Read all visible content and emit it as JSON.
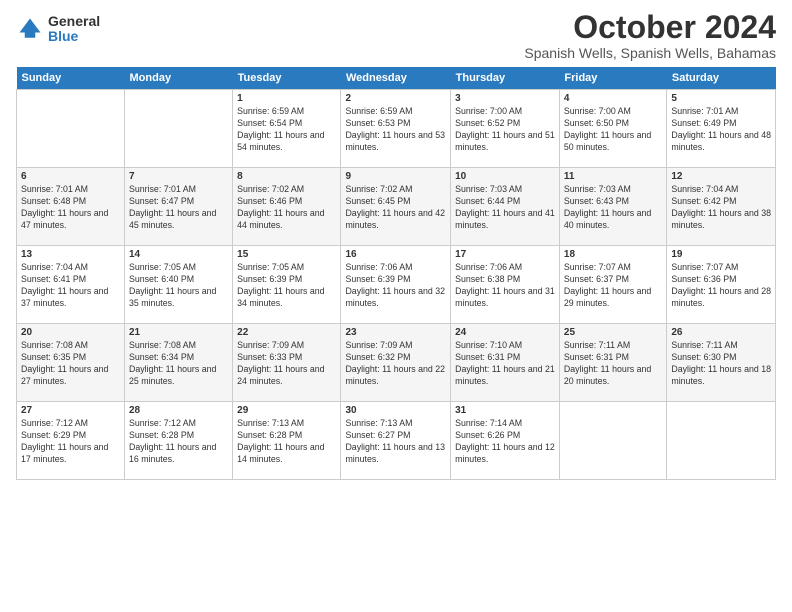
{
  "logo": {
    "general": "General",
    "blue": "Blue"
  },
  "header": {
    "month": "October 2024",
    "location": "Spanish Wells, Spanish Wells, Bahamas"
  },
  "weekdays": [
    "Sunday",
    "Monday",
    "Tuesday",
    "Wednesday",
    "Thursday",
    "Friday",
    "Saturday"
  ],
  "weeks": [
    [
      {
        "day": "",
        "sunrise": "",
        "sunset": "",
        "daylight": ""
      },
      {
        "day": "",
        "sunrise": "",
        "sunset": "",
        "daylight": ""
      },
      {
        "day": "1",
        "sunrise": "Sunrise: 6:59 AM",
        "sunset": "Sunset: 6:54 PM",
        "daylight": "Daylight: 11 hours and 54 minutes."
      },
      {
        "day": "2",
        "sunrise": "Sunrise: 6:59 AM",
        "sunset": "Sunset: 6:53 PM",
        "daylight": "Daylight: 11 hours and 53 minutes."
      },
      {
        "day": "3",
        "sunrise": "Sunrise: 7:00 AM",
        "sunset": "Sunset: 6:52 PM",
        "daylight": "Daylight: 11 hours and 51 minutes."
      },
      {
        "day": "4",
        "sunrise": "Sunrise: 7:00 AM",
        "sunset": "Sunset: 6:50 PM",
        "daylight": "Daylight: 11 hours and 50 minutes."
      },
      {
        "day": "5",
        "sunrise": "Sunrise: 7:01 AM",
        "sunset": "Sunset: 6:49 PM",
        "daylight": "Daylight: 11 hours and 48 minutes."
      }
    ],
    [
      {
        "day": "6",
        "sunrise": "Sunrise: 7:01 AM",
        "sunset": "Sunset: 6:48 PM",
        "daylight": "Daylight: 11 hours and 47 minutes."
      },
      {
        "day": "7",
        "sunrise": "Sunrise: 7:01 AM",
        "sunset": "Sunset: 6:47 PM",
        "daylight": "Daylight: 11 hours and 45 minutes."
      },
      {
        "day": "8",
        "sunrise": "Sunrise: 7:02 AM",
        "sunset": "Sunset: 6:46 PM",
        "daylight": "Daylight: 11 hours and 44 minutes."
      },
      {
        "day": "9",
        "sunrise": "Sunrise: 7:02 AM",
        "sunset": "Sunset: 6:45 PM",
        "daylight": "Daylight: 11 hours and 42 minutes."
      },
      {
        "day": "10",
        "sunrise": "Sunrise: 7:03 AM",
        "sunset": "Sunset: 6:44 PM",
        "daylight": "Daylight: 11 hours and 41 minutes."
      },
      {
        "day": "11",
        "sunrise": "Sunrise: 7:03 AM",
        "sunset": "Sunset: 6:43 PM",
        "daylight": "Daylight: 11 hours and 40 minutes."
      },
      {
        "day": "12",
        "sunrise": "Sunrise: 7:04 AM",
        "sunset": "Sunset: 6:42 PM",
        "daylight": "Daylight: 11 hours and 38 minutes."
      }
    ],
    [
      {
        "day": "13",
        "sunrise": "Sunrise: 7:04 AM",
        "sunset": "Sunset: 6:41 PM",
        "daylight": "Daylight: 11 hours and 37 minutes."
      },
      {
        "day": "14",
        "sunrise": "Sunrise: 7:05 AM",
        "sunset": "Sunset: 6:40 PM",
        "daylight": "Daylight: 11 hours and 35 minutes."
      },
      {
        "day": "15",
        "sunrise": "Sunrise: 7:05 AM",
        "sunset": "Sunset: 6:39 PM",
        "daylight": "Daylight: 11 hours and 34 minutes."
      },
      {
        "day": "16",
        "sunrise": "Sunrise: 7:06 AM",
        "sunset": "Sunset: 6:39 PM",
        "daylight": "Daylight: 11 hours and 32 minutes."
      },
      {
        "day": "17",
        "sunrise": "Sunrise: 7:06 AM",
        "sunset": "Sunset: 6:38 PM",
        "daylight": "Daylight: 11 hours and 31 minutes."
      },
      {
        "day": "18",
        "sunrise": "Sunrise: 7:07 AM",
        "sunset": "Sunset: 6:37 PM",
        "daylight": "Daylight: 11 hours and 29 minutes."
      },
      {
        "day": "19",
        "sunrise": "Sunrise: 7:07 AM",
        "sunset": "Sunset: 6:36 PM",
        "daylight": "Daylight: 11 hours and 28 minutes."
      }
    ],
    [
      {
        "day": "20",
        "sunrise": "Sunrise: 7:08 AM",
        "sunset": "Sunset: 6:35 PM",
        "daylight": "Daylight: 11 hours and 27 minutes."
      },
      {
        "day": "21",
        "sunrise": "Sunrise: 7:08 AM",
        "sunset": "Sunset: 6:34 PM",
        "daylight": "Daylight: 11 hours and 25 minutes."
      },
      {
        "day": "22",
        "sunrise": "Sunrise: 7:09 AM",
        "sunset": "Sunset: 6:33 PM",
        "daylight": "Daylight: 11 hours and 24 minutes."
      },
      {
        "day": "23",
        "sunrise": "Sunrise: 7:09 AM",
        "sunset": "Sunset: 6:32 PM",
        "daylight": "Daylight: 11 hours and 22 minutes."
      },
      {
        "day": "24",
        "sunrise": "Sunrise: 7:10 AM",
        "sunset": "Sunset: 6:31 PM",
        "daylight": "Daylight: 11 hours and 21 minutes."
      },
      {
        "day": "25",
        "sunrise": "Sunrise: 7:11 AM",
        "sunset": "Sunset: 6:31 PM",
        "daylight": "Daylight: 11 hours and 20 minutes."
      },
      {
        "day": "26",
        "sunrise": "Sunrise: 7:11 AM",
        "sunset": "Sunset: 6:30 PM",
        "daylight": "Daylight: 11 hours and 18 minutes."
      }
    ],
    [
      {
        "day": "27",
        "sunrise": "Sunrise: 7:12 AM",
        "sunset": "Sunset: 6:29 PM",
        "daylight": "Daylight: 11 hours and 17 minutes."
      },
      {
        "day": "28",
        "sunrise": "Sunrise: 7:12 AM",
        "sunset": "Sunset: 6:28 PM",
        "daylight": "Daylight: 11 hours and 16 minutes."
      },
      {
        "day": "29",
        "sunrise": "Sunrise: 7:13 AM",
        "sunset": "Sunset: 6:28 PM",
        "daylight": "Daylight: 11 hours and 14 minutes."
      },
      {
        "day": "30",
        "sunrise": "Sunrise: 7:13 AM",
        "sunset": "Sunset: 6:27 PM",
        "daylight": "Daylight: 11 hours and 13 minutes."
      },
      {
        "day": "31",
        "sunrise": "Sunrise: 7:14 AM",
        "sunset": "Sunset: 6:26 PM",
        "daylight": "Daylight: 11 hours and 12 minutes."
      },
      {
        "day": "",
        "sunrise": "",
        "sunset": "",
        "daylight": ""
      },
      {
        "day": "",
        "sunrise": "",
        "sunset": "",
        "daylight": ""
      }
    ]
  ]
}
